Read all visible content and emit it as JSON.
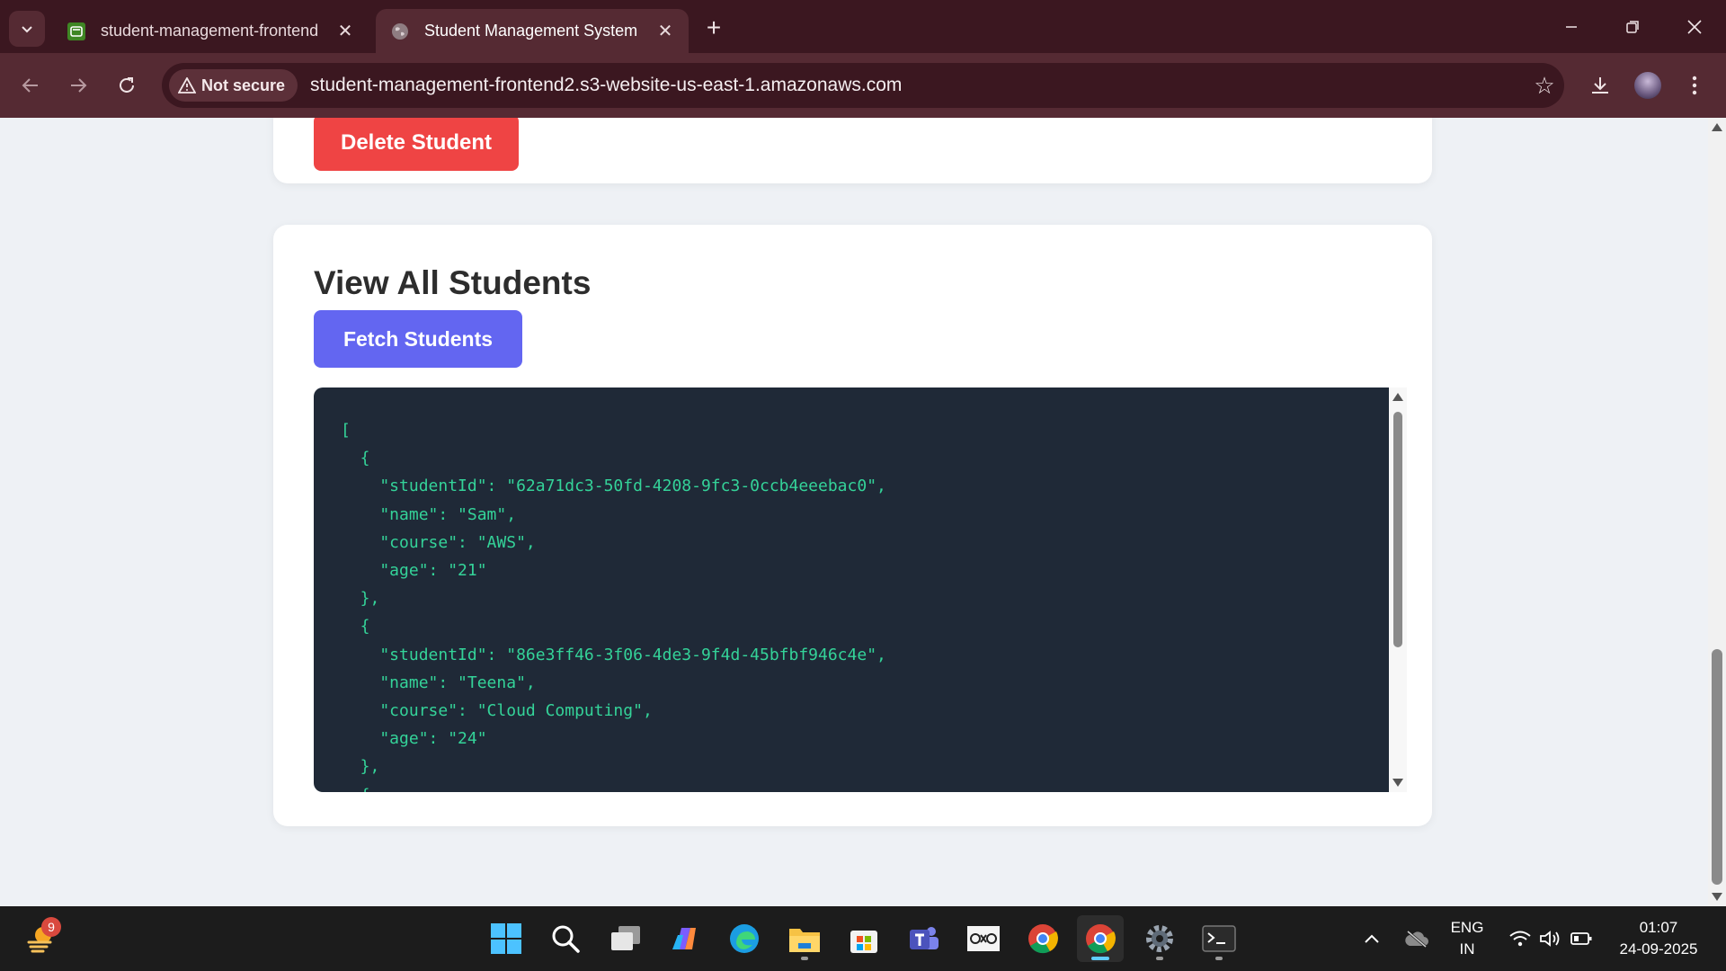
{
  "browser": {
    "tabs": [
      {
        "title": "student-management-frontend",
        "active": false
      },
      {
        "title": "Student Management System",
        "active": true
      }
    ],
    "security_label": "Not secure",
    "url": "student-management-frontend2.s3-website-us-east-1.amazonaws.com"
  },
  "page": {
    "delete_button": "Delete Student",
    "view_title": "View All Students",
    "fetch_button": "Fetch Students",
    "json_output": "[\n  {\n    \"studentId\": \"62a71dc3-50fd-4208-9fc3-0ccb4eeebac0\",\n    \"name\": \"Sam\",\n    \"course\": \"AWS\",\n    \"age\": \"21\"\n  },\n  {\n    \"studentId\": \"86e3ff46-3f06-4de3-9f4d-45bfbf946c4e\",\n    \"name\": \"Teena\",\n    \"course\": \"Cloud Computing\",\n    \"age\": \"24\"\n  },\n  {"
  },
  "taskbar": {
    "weather_badge": "9",
    "lang_line1": "ENG",
    "lang_line2": "IN",
    "time": "01:07",
    "date": "24-09-2025"
  },
  "colors": {
    "tabbar": "#3b1720",
    "toolbar": "#552a33",
    "delete_button": "#ef4444",
    "fetch_button": "#6366f1",
    "code_bg": "#1f2937",
    "code_text": "#34d399"
  }
}
